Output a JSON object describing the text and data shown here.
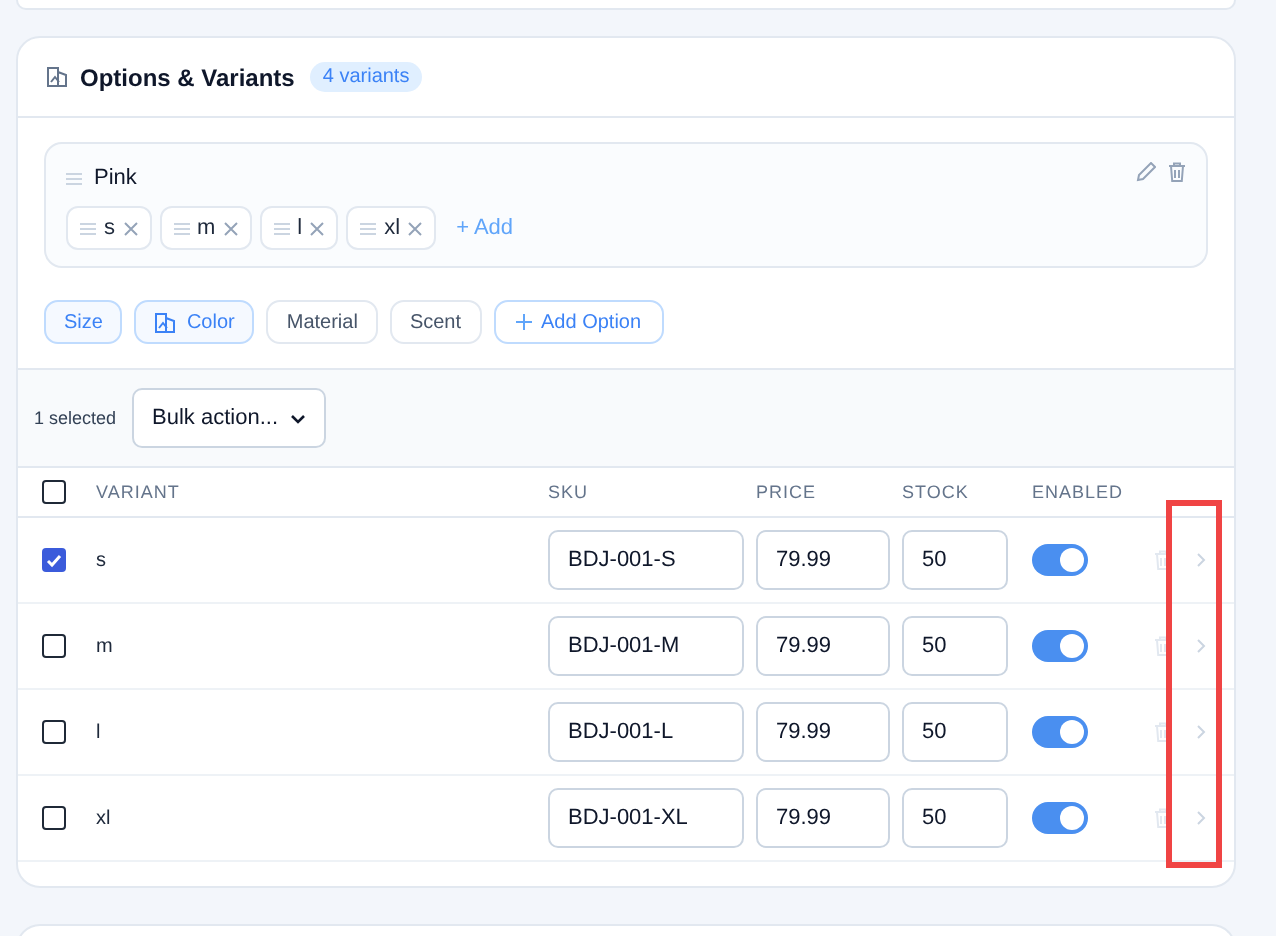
{
  "section": {
    "title": "Options & Variants",
    "badge": "4 variants"
  },
  "option_group": {
    "name": "Pink",
    "values": [
      {
        "label": "s"
      },
      {
        "label": "m"
      },
      {
        "label": "l"
      },
      {
        "label": "xl"
      }
    ],
    "add_label": "+ Add"
  },
  "option_types": [
    {
      "label": "Size",
      "selected": true,
      "kind": "plain"
    },
    {
      "label": "Color",
      "selected": true,
      "kind": "icon"
    },
    {
      "label": "Material",
      "selected": false,
      "kind": "plain"
    },
    {
      "label": "Scent",
      "selected": false,
      "kind": "plain"
    }
  ],
  "add_option_label": "Add Option",
  "bulk": {
    "selected_count": "1 selected",
    "action": "Bulk action..."
  },
  "table": {
    "select_all_checked": false,
    "columns": [
      "VARIANT",
      "SKU",
      "PRICE",
      "STOCK",
      "ENABLED"
    ],
    "rows": [
      {
        "variant": "s",
        "sku": "BDJ-001-S",
        "price": "79.99",
        "stock": "50",
        "enabled": true,
        "checked": true
      },
      {
        "variant": "m",
        "sku": "BDJ-001-M",
        "price": "79.99",
        "stock": "50",
        "enabled": true,
        "checked": false
      },
      {
        "variant": "l",
        "sku": "BDJ-001-L",
        "price": "79.99",
        "stock": "50",
        "enabled": true,
        "checked": false
      },
      {
        "variant": "xl",
        "sku": "BDJ-001-XL",
        "price": "79.99",
        "stock": "50",
        "enabled": true,
        "checked": false
      }
    ]
  }
}
